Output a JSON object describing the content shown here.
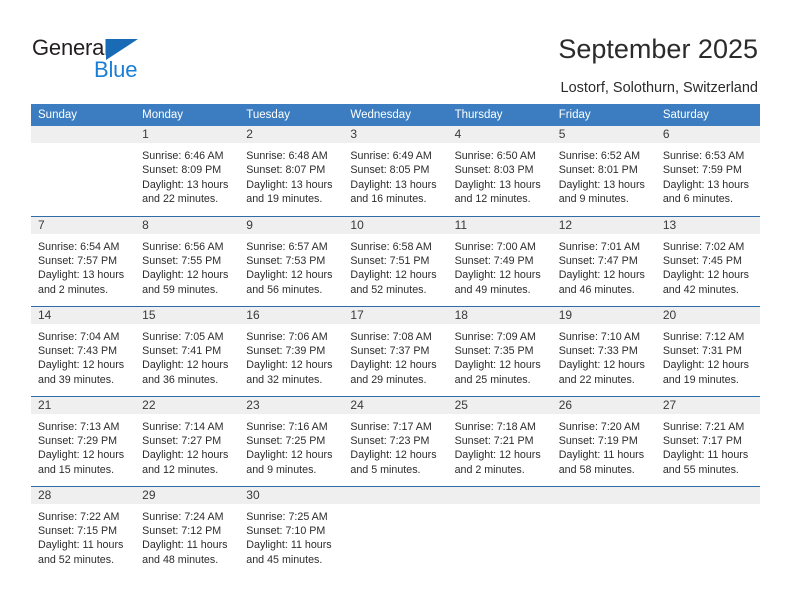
{
  "brand": {
    "name_part1": "General",
    "name_part2": "Blue",
    "triangle_color": "#1a6bb5",
    "blue_color": "#1a7fd4"
  },
  "header": {
    "title": "September 2025",
    "subtitle": "Lostorf, Solothurn, Switzerland"
  },
  "theme": {
    "header_bg": "#3b7dc0",
    "daynum_bg": "#efefef",
    "row_divider": "#2f6ca8",
    "text": "#2c2c2c"
  },
  "weekdays": [
    "Sunday",
    "Monday",
    "Tuesday",
    "Wednesday",
    "Thursday",
    "Friday",
    "Saturday"
  ],
  "weeks": [
    [
      {
        "day": "",
        "empty": true,
        "sunrise": "",
        "sunset": "",
        "daylight_line1": "",
        "daylight_line2": ""
      },
      {
        "day": "1",
        "sunrise": "Sunrise: 6:46 AM",
        "sunset": "Sunset: 8:09 PM",
        "daylight_line1": "Daylight: 13 hours",
        "daylight_line2": "and 22 minutes."
      },
      {
        "day": "2",
        "sunrise": "Sunrise: 6:48 AM",
        "sunset": "Sunset: 8:07 PM",
        "daylight_line1": "Daylight: 13 hours",
        "daylight_line2": "and 19 minutes."
      },
      {
        "day": "3",
        "sunrise": "Sunrise: 6:49 AM",
        "sunset": "Sunset: 8:05 PM",
        "daylight_line1": "Daylight: 13 hours",
        "daylight_line2": "and 16 minutes."
      },
      {
        "day": "4",
        "sunrise": "Sunrise: 6:50 AM",
        "sunset": "Sunset: 8:03 PM",
        "daylight_line1": "Daylight: 13 hours",
        "daylight_line2": "and 12 minutes."
      },
      {
        "day": "5",
        "sunrise": "Sunrise: 6:52 AM",
        "sunset": "Sunset: 8:01 PM",
        "daylight_line1": "Daylight: 13 hours",
        "daylight_line2": "and 9 minutes."
      },
      {
        "day": "6",
        "sunrise": "Sunrise: 6:53 AM",
        "sunset": "Sunset: 7:59 PM",
        "daylight_line1": "Daylight: 13 hours",
        "daylight_line2": "and 6 minutes."
      }
    ],
    [
      {
        "day": "7",
        "sunrise": "Sunrise: 6:54 AM",
        "sunset": "Sunset: 7:57 PM",
        "daylight_line1": "Daylight: 13 hours",
        "daylight_line2": "and 2 minutes."
      },
      {
        "day": "8",
        "sunrise": "Sunrise: 6:56 AM",
        "sunset": "Sunset: 7:55 PM",
        "daylight_line1": "Daylight: 12 hours",
        "daylight_line2": "and 59 minutes."
      },
      {
        "day": "9",
        "sunrise": "Sunrise: 6:57 AM",
        "sunset": "Sunset: 7:53 PM",
        "daylight_line1": "Daylight: 12 hours",
        "daylight_line2": "and 56 minutes."
      },
      {
        "day": "10",
        "sunrise": "Sunrise: 6:58 AM",
        "sunset": "Sunset: 7:51 PM",
        "daylight_line1": "Daylight: 12 hours",
        "daylight_line2": "and 52 minutes."
      },
      {
        "day": "11",
        "sunrise": "Sunrise: 7:00 AM",
        "sunset": "Sunset: 7:49 PM",
        "daylight_line1": "Daylight: 12 hours",
        "daylight_line2": "and 49 minutes."
      },
      {
        "day": "12",
        "sunrise": "Sunrise: 7:01 AM",
        "sunset": "Sunset: 7:47 PM",
        "daylight_line1": "Daylight: 12 hours",
        "daylight_line2": "and 46 minutes."
      },
      {
        "day": "13",
        "sunrise": "Sunrise: 7:02 AM",
        "sunset": "Sunset: 7:45 PM",
        "daylight_line1": "Daylight: 12 hours",
        "daylight_line2": "and 42 minutes."
      }
    ],
    [
      {
        "day": "14",
        "sunrise": "Sunrise: 7:04 AM",
        "sunset": "Sunset: 7:43 PM",
        "daylight_line1": "Daylight: 12 hours",
        "daylight_line2": "and 39 minutes."
      },
      {
        "day": "15",
        "sunrise": "Sunrise: 7:05 AM",
        "sunset": "Sunset: 7:41 PM",
        "daylight_line1": "Daylight: 12 hours",
        "daylight_line2": "and 36 minutes."
      },
      {
        "day": "16",
        "sunrise": "Sunrise: 7:06 AM",
        "sunset": "Sunset: 7:39 PM",
        "daylight_line1": "Daylight: 12 hours",
        "daylight_line2": "and 32 minutes."
      },
      {
        "day": "17",
        "sunrise": "Sunrise: 7:08 AM",
        "sunset": "Sunset: 7:37 PM",
        "daylight_line1": "Daylight: 12 hours",
        "daylight_line2": "and 29 minutes."
      },
      {
        "day": "18",
        "sunrise": "Sunrise: 7:09 AM",
        "sunset": "Sunset: 7:35 PM",
        "daylight_line1": "Daylight: 12 hours",
        "daylight_line2": "and 25 minutes."
      },
      {
        "day": "19",
        "sunrise": "Sunrise: 7:10 AM",
        "sunset": "Sunset: 7:33 PM",
        "daylight_line1": "Daylight: 12 hours",
        "daylight_line2": "and 22 minutes."
      },
      {
        "day": "20",
        "sunrise": "Sunrise: 7:12 AM",
        "sunset": "Sunset: 7:31 PM",
        "daylight_line1": "Daylight: 12 hours",
        "daylight_line2": "and 19 minutes."
      }
    ],
    [
      {
        "day": "21",
        "sunrise": "Sunrise: 7:13 AM",
        "sunset": "Sunset: 7:29 PM",
        "daylight_line1": "Daylight: 12 hours",
        "daylight_line2": "and 15 minutes."
      },
      {
        "day": "22",
        "sunrise": "Sunrise: 7:14 AM",
        "sunset": "Sunset: 7:27 PM",
        "daylight_line1": "Daylight: 12 hours",
        "daylight_line2": "and 12 minutes."
      },
      {
        "day": "23",
        "sunrise": "Sunrise: 7:16 AM",
        "sunset": "Sunset: 7:25 PM",
        "daylight_line1": "Daylight: 12 hours",
        "daylight_line2": "and 9 minutes."
      },
      {
        "day": "24",
        "sunrise": "Sunrise: 7:17 AM",
        "sunset": "Sunset: 7:23 PM",
        "daylight_line1": "Daylight: 12 hours",
        "daylight_line2": "and 5 minutes."
      },
      {
        "day": "25",
        "sunrise": "Sunrise: 7:18 AM",
        "sunset": "Sunset: 7:21 PM",
        "daylight_line1": "Daylight: 12 hours",
        "daylight_line2": "and 2 minutes."
      },
      {
        "day": "26",
        "sunrise": "Sunrise: 7:20 AM",
        "sunset": "Sunset: 7:19 PM",
        "daylight_line1": "Daylight: 11 hours",
        "daylight_line2": "and 58 minutes."
      },
      {
        "day": "27",
        "sunrise": "Sunrise: 7:21 AM",
        "sunset": "Sunset: 7:17 PM",
        "daylight_line1": "Daylight: 11 hours",
        "daylight_line2": "and 55 minutes."
      }
    ],
    [
      {
        "day": "28",
        "sunrise": "Sunrise: 7:22 AM",
        "sunset": "Sunset: 7:15 PM",
        "daylight_line1": "Daylight: 11 hours",
        "daylight_line2": "and 52 minutes."
      },
      {
        "day": "29",
        "sunrise": "Sunrise: 7:24 AM",
        "sunset": "Sunset: 7:12 PM",
        "daylight_line1": "Daylight: 11 hours",
        "daylight_line2": "and 48 minutes."
      },
      {
        "day": "30",
        "sunrise": "Sunrise: 7:25 AM",
        "sunset": "Sunset: 7:10 PM",
        "daylight_line1": "Daylight: 11 hours",
        "daylight_line2": "and 45 minutes."
      },
      {
        "day": "",
        "empty": true,
        "sunrise": "",
        "sunset": "",
        "daylight_line1": "",
        "daylight_line2": ""
      },
      {
        "day": "",
        "empty": true,
        "sunrise": "",
        "sunset": "",
        "daylight_line1": "",
        "daylight_line2": ""
      },
      {
        "day": "",
        "empty": true,
        "sunrise": "",
        "sunset": "",
        "daylight_line1": "",
        "daylight_line2": ""
      },
      {
        "day": "",
        "empty": true,
        "sunrise": "",
        "sunset": "",
        "daylight_line1": "",
        "daylight_line2": ""
      }
    ]
  ]
}
